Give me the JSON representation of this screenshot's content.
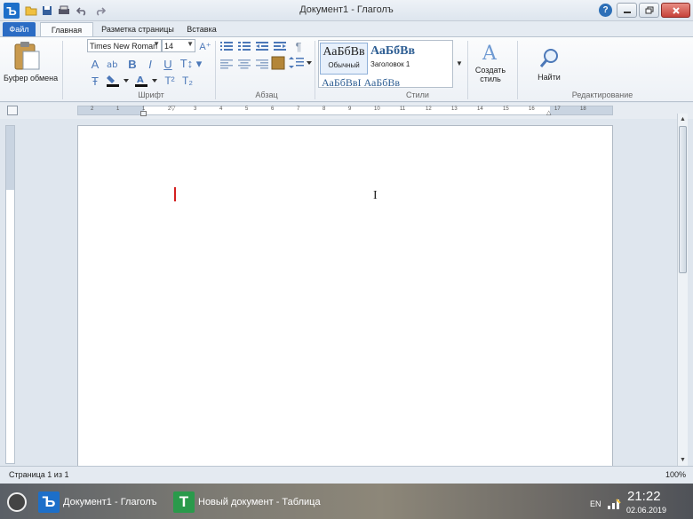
{
  "window": {
    "title": "Документ1 - Глаголъ",
    "logo_letter": "Ъ",
    "accent": "#1d6fc9"
  },
  "quick_access": [
    "folder-icon",
    "save-icon",
    "print-icon",
    "undo-icon",
    "redo-icon"
  ],
  "tabs": {
    "file": "Файл",
    "home": "Главная",
    "layout": "Разметка страницы",
    "insert": "Вставка"
  },
  "ribbon": {
    "clipboard": {
      "paste_label": "Буфер обмена"
    },
    "font": {
      "group_label": "Шрифт",
      "font_name": "Times New Roman",
      "font_size": "14"
    },
    "paragraph": {
      "group_label": "Абзац"
    },
    "styles": {
      "group_label": "Стили",
      "items": [
        {
          "preview": "АаБбВв",
          "name": "Обычный"
        },
        {
          "preview": "АаБбВв",
          "name": "Заголовок 1"
        }
      ],
      "row2_preview": "АаБбВвІ  АаБбВв"
    },
    "create_style": {
      "line1": "Создать",
      "line2": "стиль"
    },
    "editing": {
      "group_label": "Редактирование",
      "find_label": "Найти"
    }
  },
  "ruler": {
    "numbers": [
      "2",
      "1",
      "1",
      "2",
      "3",
      "4",
      "5",
      "6",
      "7",
      "8",
      "9",
      "10",
      "11",
      "12",
      "13",
      "14",
      "15",
      "16",
      "17",
      "18"
    ]
  },
  "statusbar": {
    "page_info": "Страница 1 из 1",
    "zoom": "100%"
  },
  "taskbar": {
    "items": [
      {
        "icon_letter": "Ъ",
        "label": "Документ1 - Глаголъ",
        "color": "#1d6fc9"
      },
      {
        "icon_letter": "Т",
        "label": "Новый документ - Таблица",
        "color": "#2a9a4b"
      }
    ],
    "lang": "EN",
    "time": "21:22",
    "date": "02.06.2019"
  }
}
